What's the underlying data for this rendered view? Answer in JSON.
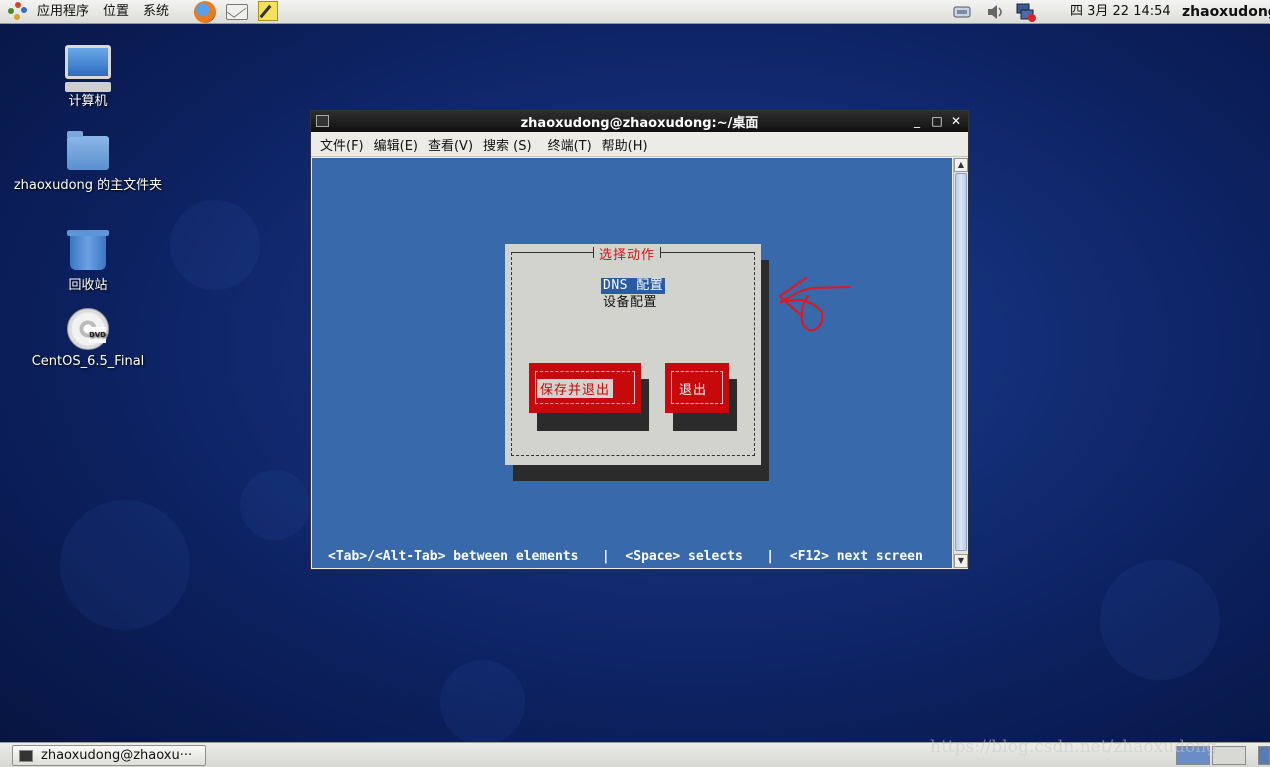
{
  "top_panel": {
    "menus": [
      "应用程序",
      "位置",
      "系统"
    ],
    "launchers": [
      "firefox-icon",
      "mail-icon",
      "notes-icon"
    ],
    "tray": [
      "network-icon",
      "volume-icon",
      "network-disconnected-icon"
    ],
    "clock": "四 3月 22 14:54",
    "user": "zhaoxudong"
  },
  "desktop": {
    "icons": [
      {
        "label": "计算机",
        "icon": "computer-icon"
      },
      {
        "label": "zhaoxudong 的主文件夹",
        "icon": "home-folder-icon"
      },
      {
        "label": "回收站",
        "icon": "trash-icon"
      },
      {
        "label": "CentOS_6.5_Final",
        "icon": "dvd-icon"
      }
    ]
  },
  "window": {
    "title": "zhaoxudong@zhaoxudong:~/桌面",
    "controls": {
      "minimize": "_",
      "maximize": "□",
      "close": "✕"
    },
    "menus": [
      "文件(F)",
      "编辑(E)",
      "查看(V)",
      "搜索 (S)",
      "终端(T)",
      "帮助(H)"
    ]
  },
  "dialog": {
    "title": "选择动作",
    "options": [
      "DNS 配置",
      "设备配置"
    ],
    "selected_index": 0,
    "buttons": {
      "save_quit": "保存并退出",
      "quit": "退出"
    },
    "hints": "<Tab>/<Alt-Tab> between elements   |  <Space> selects   |  <F12> next screen"
  },
  "taskbar": {
    "task": "zhaoxudong@zhaoxu···"
  },
  "watermark": "https://blog.csdn.net/zhaoxudong",
  "colors": {
    "terminal_bg": "#3769ab",
    "dialog_bg": "#d3d3ce",
    "button_red": "#c8090b",
    "title_red": "#d21313",
    "selection": "#2a5ba6",
    "annotation_red": "#e8141c"
  }
}
